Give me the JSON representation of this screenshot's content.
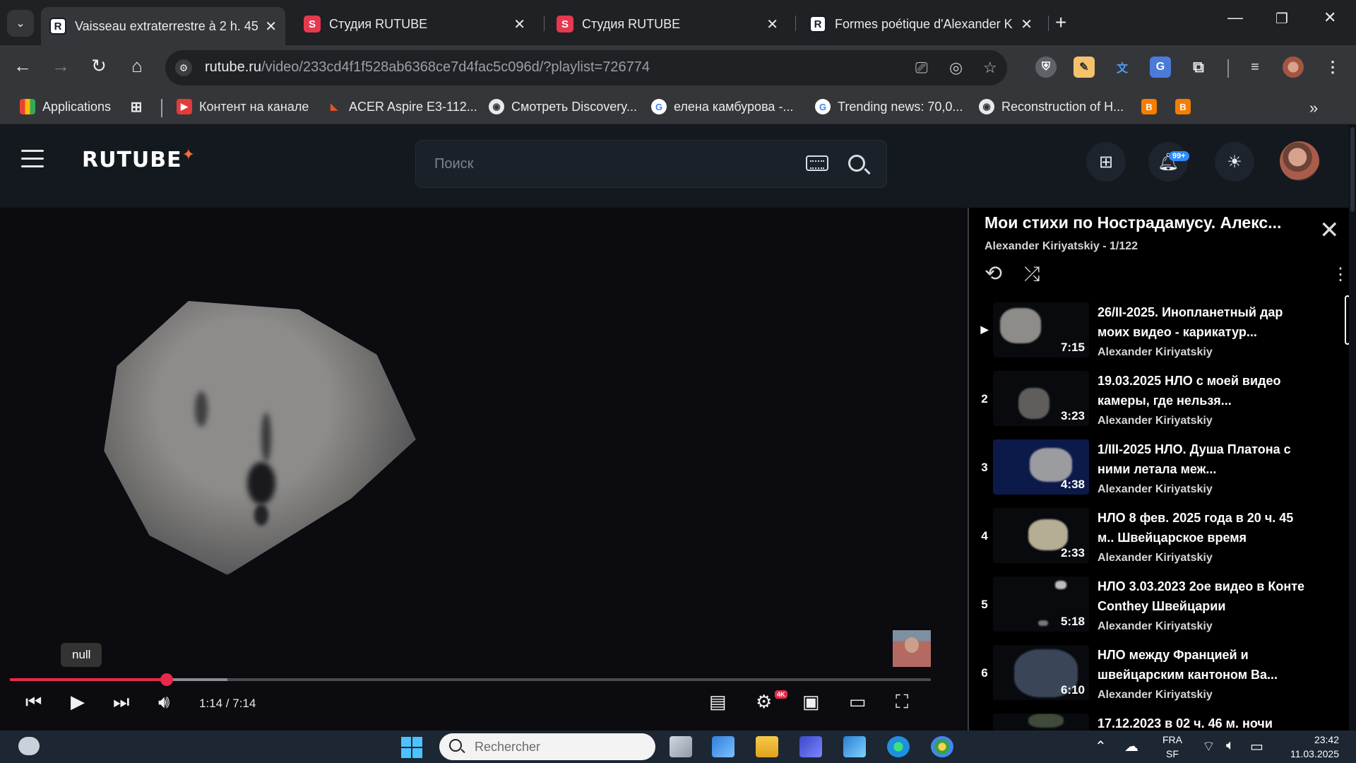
{
  "browser": {
    "tabs": [
      {
        "title": "Vaisseau extraterrestre à 2 h. 45",
        "favicon": "R",
        "active": true
      },
      {
        "title": "Студия RUTUBE",
        "favicon": "S",
        "active": false
      },
      {
        "title": "Студия RUTUBE",
        "favicon": "S",
        "active": false
      },
      {
        "title": "Formes poétique d'Alexander K",
        "favicon": "R",
        "active": false
      }
    ],
    "url_host": "rutube.ru",
    "url_path": "/video/233cd4f1f528ab6368ce7d4fac5c096d/?playlist=726774",
    "bookmarks": [
      {
        "label": "Applications",
        "icon": "apps-grid-icon"
      },
      {
        "label": "Контент на канале",
        "icon": "youtube-icon"
      },
      {
        "label": "ACER Aspire E3-112...",
        "icon": "acer-icon"
      },
      {
        "label": "Смотреть Discovery...",
        "icon": "globe-icon"
      },
      {
        "label": "елена камбурова -...",
        "icon": "google-icon"
      },
      {
        "label": "Trending news: 70,0...",
        "icon": "google-icon"
      },
      {
        "label": "Reconstruction of H...",
        "icon": "globe-icon"
      }
    ]
  },
  "rutube": {
    "logo": "RUTUBE",
    "search_placeholder": "Поиск",
    "notifications_badge": "99+"
  },
  "player": {
    "tooltip": "null",
    "current_time": "1:14",
    "duration": "7:14",
    "time_label": "1:14 / 7:14",
    "progress_fraction": 0.17,
    "buffer_fraction": 0.236,
    "quality_badge": "4K",
    "accent_color": "#e8294a"
  },
  "playlist": {
    "title": "Мои стихи по Нострадамусу. Алекс...",
    "subtitle": "Alexander Kiriyatskiy - 1/122",
    "items": [
      {
        "index": "▶",
        "title": "26/II-2025. Инопланетный дар моих видео - карикатур...",
        "channel": "Alexander Kiriyatskiy",
        "duration": "7:15"
      },
      {
        "index": "2",
        "title": "19.03.2025 НЛО с моей видео камеры, где нельзя...",
        "channel": "Alexander Kiriyatskiy",
        "duration": "3:23"
      },
      {
        "index": "3",
        "title": "1/III-2025 НЛО. Душа Платона с ними летала меж...",
        "channel": "Alexander Kiriyatskiy",
        "duration": "4:38"
      },
      {
        "index": "4",
        "title": "НЛО 8 фев. 2025 года в 20 ч. 45 м.. Швейцарское время",
        "channel": "Alexander Kiriyatskiy",
        "duration": "2:33"
      },
      {
        "index": "5",
        "title": "НЛО 3.03.2023 2ое видео в Конте Conthey Швейцарии",
        "channel": "Alexander Kiriyatskiy",
        "duration": "5:18"
      },
      {
        "index": "6",
        "title": "НЛО между Францией и швейцарским кантоном Ва...",
        "channel": "Alexander Kiriyatskiy",
        "duration": "6:10"
      },
      {
        "index": "",
        "title": "17.12.2023 в 02 ч. 46 м. ночи",
        "channel": "",
        "duration": ""
      }
    ]
  },
  "taskbar": {
    "search_placeholder": "Rechercher",
    "lang_top": "FRA",
    "lang_bottom": "SF",
    "time": "23:42",
    "date": "11.03.2025"
  }
}
